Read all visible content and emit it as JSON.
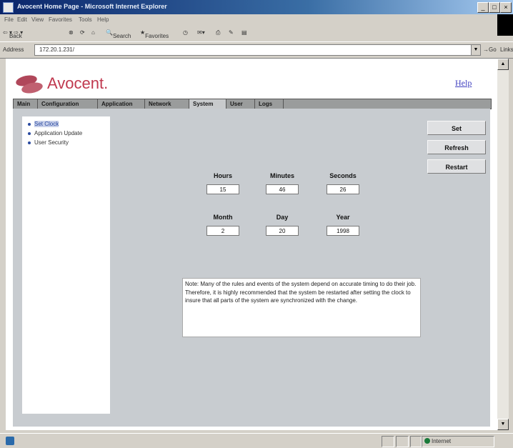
{
  "window": {
    "title": "Avocent Home Page - Microsoft Internet Explorer",
    "menu": [
      "File",
      "Edit",
      "View",
      "Favorites",
      "Tools",
      "Help"
    ],
    "toolbar": [
      "Back",
      "Search",
      "Favorites"
    ],
    "address_label": "Address",
    "address_value": "172.20.1.231/",
    "go_label": "Go",
    "links_label": "Links"
  },
  "header": {
    "logo_text": "Avocent.",
    "help_link": "Help"
  },
  "tabs": [
    {
      "label": "Main",
      "active": false
    },
    {
      "label": "Configuration",
      "active": false
    },
    {
      "label": "Application",
      "active": false
    },
    {
      "label": "Network",
      "active": false
    },
    {
      "label": "System",
      "active": true
    },
    {
      "label": "User",
      "active": false
    },
    {
      "label": "Logs",
      "active": false
    }
  ],
  "nav": [
    {
      "label": "Set Clock",
      "selected": true
    },
    {
      "label": "Application Update",
      "selected": false
    },
    {
      "label": "User Security",
      "selected": false
    }
  ],
  "actions": {
    "set": "Set",
    "refresh": "Refresh",
    "restart": "Restart"
  },
  "clock": {
    "hours": {
      "label": "Hours",
      "value": "15"
    },
    "minutes": {
      "label": "Minutes",
      "value": "46"
    },
    "seconds": {
      "label": "Seconds",
      "value": "26"
    },
    "month": {
      "label": "Month",
      "value": "2"
    },
    "day": {
      "label": "Day",
      "value": "20"
    },
    "year": {
      "label": "Year",
      "value": "1998"
    }
  },
  "note": "Note:  Many of the rules and events of the system depend on accurate timing to do their job.  Therefore, it is highly recommended that the system be restarted after setting the clock to insure that all parts of the system are synchronized with the change.",
  "status": {
    "zone": "Internet"
  },
  "colors": {
    "brand": "#c0394f",
    "content_bg": "#c8ccd0",
    "tab_bar": "#9a9c9c"
  }
}
